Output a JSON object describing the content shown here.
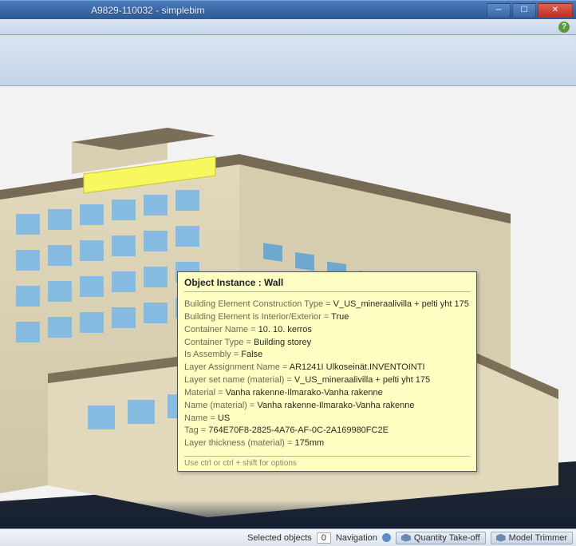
{
  "window": {
    "title": "A9829-110032 - simplebim"
  },
  "tooltip": {
    "title": "Object Instance : Wall",
    "rows": [
      {
        "label": "Building Element Construction Type",
        "value": "V_US_mineraalivilla + pelti yht 175"
      },
      {
        "label": "Building Element is Interior/Exterior",
        "value": "True"
      },
      {
        "label": "Container Name",
        "value": "10. 10. kerros"
      },
      {
        "label": "Container Type",
        "value": "Building storey"
      },
      {
        "label": "Is Assembly",
        "value": "False"
      },
      {
        "label": "Layer Assignment Name",
        "value": "AR1241I Ulkoseinät.INVENTOINTI"
      },
      {
        "label": "Layer set name (material)",
        "value": "V_US_mineraalivilla + pelti yht 175"
      },
      {
        "label": "Material",
        "value": "Vanha rakenne-Ilmarako-Vanha rakenne"
      },
      {
        "label": "Name (material)",
        "value": "Vanha rakenne-Ilmarako-Vanha rakenne"
      },
      {
        "label": "Name",
        "value": "US"
      },
      {
        "label": "Tag",
        "value": "764E70F8-2825-4A76-AF-0C-2A169980FC2E"
      },
      {
        "label": "Layer thickness (material)",
        "value": "175mm"
      }
    ],
    "hint": "Use ctrl or ctrl + shift for options"
  },
  "statusbar": {
    "selected_label": "Selected objects",
    "selected_count": "0",
    "tabs": [
      {
        "label": "Quantity Take-off"
      },
      {
        "label": "Model Trimmer"
      }
    ],
    "nav_label": "Navigation"
  }
}
